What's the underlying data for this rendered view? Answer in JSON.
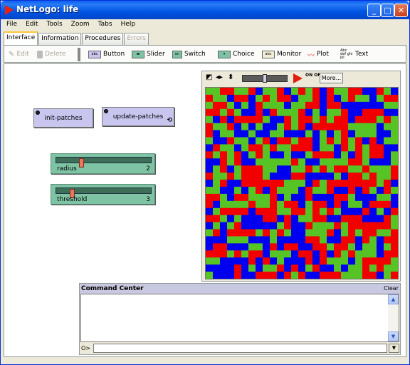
{
  "window": {
    "title": "NetLogo: life",
    "buttons": {
      "minimize": "_",
      "maximize": "□",
      "close": "✕"
    }
  },
  "menu": [
    "File",
    "Edit",
    "Tools",
    "Zoom",
    "Tabs",
    "Help"
  ],
  "tabs": [
    {
      "label": "Interface",
      "active": true,
      "disabled": false
    },
    {
      "label": "Information",
      "active": false,
      "disabled": false
    },
    {
      "label": "Procedures",
      "active": false,
      "disabled": false
    },
    {
      "label": "Errors",
      "active": false,
      "disabled": true
    }
  ],
  "toolbar": {
    "edit_label": "Edit",
    "delete_label": "Delete",
    "button_label": "Button",
    "slider_label": "Slider",
    "switch_label": "Switch",
    "choice_label": "Choice",
    "monitor_label": "Monitor",
    "plot_label": "Plot",
    "text_label": "Text"
  },
  "widgets": {
    "init_button": "init-patches",
    "update_button": "update-patches",
    "radius": {
      "label": "radius",
      "value": "2",
      "fraction": 0.25
    },
    "threshold": {
      "label": "threshold",
      "value": "3",
      "fraction": 0.15
    }
  },
  "view": {
    "more_label": "More...",
    "onoff_label": "ON OFF",
    "speed_fraction": 0.5,
    "cols": 27,
    "rows": 27,
    "colors": {
      "red": "#f20000",
      "green": "#56c424",
      "blue": "#0000f0"
    }
  },
  "command_center": {
    "title": "Command Center",
    "clear_label": "Clear",
    "prompt": "O>"
  },
  "colors": {
    "button_bg": "#c8c5ef",
    "slider_bg": "#7ec3a4",
    "titlebar": "#0054e3"
  }
}
